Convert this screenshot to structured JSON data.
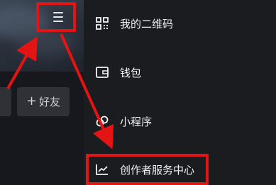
{
  "header": {
    "menu_icon": "hamburger-menu-icon"
  },
  "profile": {
    "add_friend": {
      "icon": "plus-icon",
      "label": "好友"
    }
  },
  "drawer": {
    "items": [
      {
        "icon": "qr-code-icon",
        "label": "我的二维码"
      },
      {
        "icon": "wallet-icon",
        "label": "钱包"
      },
      {
        "icon": "mini-program-icon",
        "label": "小程序"
      },
      {
        "icon": "chart-trend-icon",
        "label": "创作者服务中心"
      }
    ]
  },
  "colors": {
    "annotation_red": "#e31414",
    "drawer_background": "#1b1c20",
    "text": "#f1f2f4"
  }
}
